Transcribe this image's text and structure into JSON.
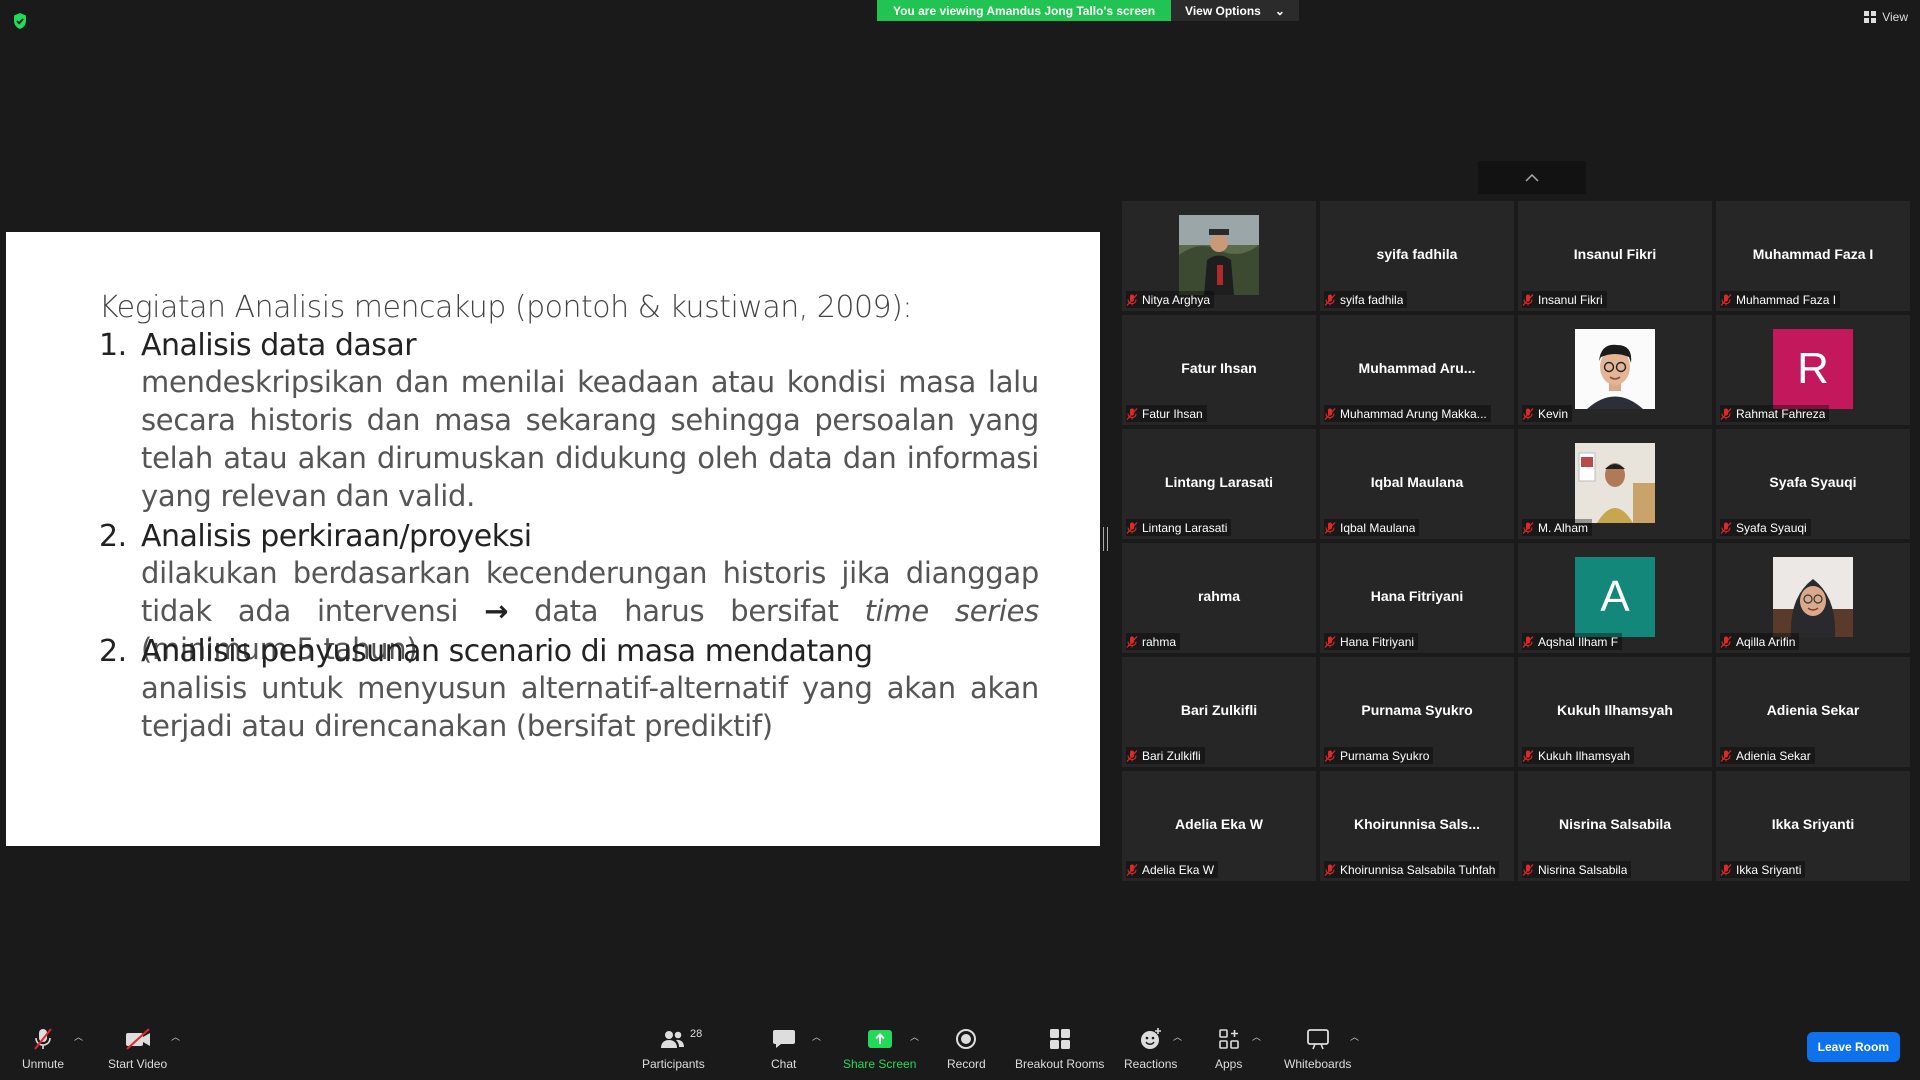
{
  "topbar": {
    "viewing_text": "You are viewing Amandus Jong Tallo's screen",
    "view_options_label": "View Options",
    "view_label": "View"
  },
  "slide": {
    "intro": "Kegiatan Analisis mencakup (pontoh & kustiwan, 2009):",
    "items": [
      {
        "num": "1.",
        "title": "Analisis data dasar",
        "body": "mendeskripsikan dan menilai keadaan atau kondisi masa lalu secara historis dan masa sekarang sehingga persoalan yang telah atau akan  dirumuskan didukung oleh data dan informasi yang relevan dan valid."
      },
      {
        "num": "2.",
        "title": "Analisis perkiraan/proyeksi",
        "body_a": "dilakukan berdasarkan kecenderungan historis jika dianggap tidak ada intervensi ",
        "arrow": "→",
        "body_b": " data harus bersifat ",
        "body_em": "time series",
        "body_c": " (minimum 5 tahun)"
      },
      {
        "num": "2.",
        "title": "Analisis penyusunan scenario di masa mendatang",
        "body": "analisis untuk menyusun alternatif-alternatif yang akan akan terjadi atau direncanakan (bersifat prediktif)"
      }
    ]
  },
  "participants": [
    {
      "big": "",
      "name": "Nitya Arghya",
      "photo": "nitya"
    },
    {
      "big": "syifa fadhila",
      "name": "syifa fadhila"
    },
    {
      "big": "Insanul Fikri",
      "name": "Insanul Fikri"
    },
    {
      "big": "Muhammad Faza I",
      "name": "Muhammad Faza I"
    },
    {
      "big": "Fatur Ihsan",
      "name": "Fatur Ihsan"
    },
    {
      "big": "Muhammad  Aru...",
      "name": "Muhammad Arung Makka..."
    },
    {
      "big": "",
      "name": "Kevin",
      "photo": "kevin"
    },
    {
      "big": "",
      "name": "Rahmat Fahreza",
      "letter": "R",
      "letter_color": "#c3185c"
    },
    {
      "big": "Lintang Larasati",
      "name": "Lintang Larasati"
    },
    {
      "big": "Iqbal Maulana",
      "name": "Iqbal Maulana"
    },
    {
      "big": "",
      "name": "M. Alham",
      "photo": "alham"
    },
    {
      "big": "Syafa Syauqi",
      "name": "Syafa Syauqi"
    },
    {
      "big": "rahma",
      "name": "rahma"
    },
    {
      "big": "Hana Fitriyani",
      "name": "Hana Fitriyani"
    },
    {
      "big": "",
      "name": "Aqshal Ilham F",
      "letter": "A",
      "letter_color": "#13877a"
    },
    {
      "big": "",
      "name": "Aqilla Arifin",
      "photo": "aqilla"
    },
    {
      "big": "Bari Zulkifli",
      "name": "Bari Zulkifli"
    },
    {
      "big": "Purnama Syukro",
      "name": "Purnama Syukro"
    },
    {
      "big": "Kukuh Ilhamsyah",
      "name": "Kukuh Ilhamsyah"
    },
    {
      "big": "Adienia Sekar",
      "name": "Adienia Sekar"
    },
    {
      "big": "Adelia Eka W",
      "name": "Adelia Eka W"
    },
    {
      "big": "Khoirunnisa  Sals...",
      "name": "Khoirunnisa Salsabila Tuhfah"
    },
    {
      "big": "Nisrina Salsabila",
      "name": "Nisrina Salsabila"
    },
    {
      "big": "Ikka Sriyanti",
      "name": "Ikka Sriyanti"
    }
  ],
  "toolbar": {
    "unmute": "Unmute",
    "start_video": "Start Video",
    "participants": "Participants",
    "participants_count": "28",
    "chat": "Chat",
    "share_screen": "Share Screen",
    "record": "Record",
    "breakout_rooms": "Breakout Rooms",
    "reactions": "Reactions",
    "apps": "Apps",
    "whiteboards": "Whiteboards",
    "leave_room": "Leave Room"
  },
  "colors": {
    "banner_green": "#21c452",
    "share_green": "#23d959",
    "leave_blue": "#0e72ed",
    "muted_red": "#e02828"
  }
}
